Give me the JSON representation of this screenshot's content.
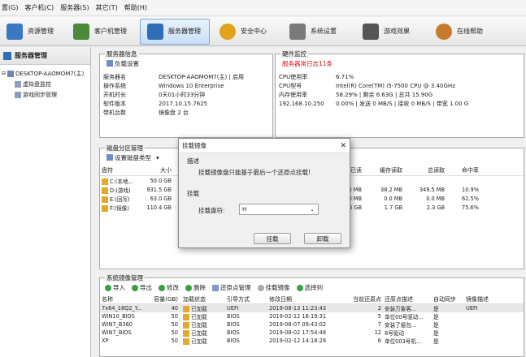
{
  "menu": [
    "置(G)",
    "客户机(C)",
    "服务器(S)",
    "其它(T)",
    "帮助(H)"
  ],
  "toolbar": [
    {
      "label": "资源管理",
      "color": "#3b78c2"
    },
    {
      "label": "客户机管理",
      "color": "#4a8a3a"
    },
    {
      "label": "服务器管理",
      "color": "#2f6db5"
    },
    {
      "label": "安全中心",
      "color": "#e2a21a"
    },
    {
      "label": "系统设置",
      "color": "#7a7a7a"
    },
    {
      "label": "游戏效果",
      "color": "#555555"
    },
    {
      "label": "在线帮助",
      "color": "#c77b2a"
    }
  ],
  "sidebar": {
    "title": "服务器管理",
    "tree": [
      {
        "label": "DESKTOP-AAOMOM7(主)",
        "indent": 0
      },
      {
        "label": "虚拟盘监控",
        "indent": 1
      },
      {
        "label": "游戏同步管理",
        "indent": 1
      }
    ]
  },
  "server_info": {
    "title": "服务器信息",
    "tool": "负载设置",
    "rows": [
      {
        "k": "服务器名",
        "v": "DESKTOP-AAOMOM7(主) | 启用"
      },
      {
        "k": "操作系统",
        "v": "Windows 10 Enterprise"
      },
      {
        "k": "开机时长",
        "v": "0天01小时33分钟"
      },
      {
        "k": "软件版本",
        "v": "2017.10.15.7625"
      },
      {
        "k": "带机台数",
        "v": "镜像盘 2 台"
      }
    ]
  },
  "hw": {
    "title": "硬件监控",
    "alert": "服务器常日志11条",
    "rows": [
      {
        "k": "CPU使用率",
        "v": "6.71%"
      },
      {
        "k": "CPU型号",
        "v": "Intel(R) Core(TM) i5-7500 CPU @ 3.40GHz"
      },
      {
        "k": "内存使用率",
        "v": "58.29% | 剩余 6.63G | 总共 15.90G"
      },
      {
        "k": "192.168.10.250",
        "v": "0.00% | 发送 0 MB/S | 接收 0 MB/S | 带宽 1.00 G"
      }
    ]
  },
  "disk": {
    "title": "磁盘分区管理",
    "tool": "设置磁盘类型",
    "headers": {
      "name": "盘符",
      "size": "大小",
      "hit_left": "已读",
      "cache": "缓存读取",
      "total": "总读取",
      "hit": "命中率"
    },
    "rows": [
      {
        "name": "C:(本地...",
        "size": "50.0 GB",
        "read": "",
        "cache": "",
        "total": "",
        "hit": ""
      },
      {
        "name": "D:(游戏)",
        "size": "931.5 GB",
        "read": "1.3 MB",
        "cache": "38.2 MB",
        "total": "349.5 MB",
        "hit": "10.9%"
      },
      {
        "name": "E:(回写)",
        "size": "63.0 GB",
        "read": "0.0 MB",
        "cache": "0.0 MB",
        "total": "0.0 MB",
        "hit": "62.5%"
      },
      {
        "name": "F:(镜像)",
        "size": "110.4 GB",
        "read": "1.6 GB",
        "cache": "1.7 GB",
        "total": "2.3 GB",
        "hit": "75.6%"
      }
    ]
  },
  "dialog": {
    "title": "挂载镜像",
    "desc_label": "描述",
    "desc": "挂载镜像盘只能基于最后一个还原点挂载!",
    "mount_label": "挂载",
    "disk_label": "挂载盘符:",
    "disk_value": "H",
    "ok": "挂载",
    "cancel": "卸载"
  },
  "image": {
    "title": "系统镜像管理",
    "tools": [
      "导入",
      "导出",
      "修改",
      "删除",
      "还原点管理",
      "挂载镜像",
      "选择列"
    ],
    "headers": [
      "名称",
      "容量(GB)",
      "加载状态",
      "引导方式",
      "修改日期",
      "当前还原点",
      "还原点描述",
      "自动同步",
      "镜像描述"
    ],
    "rows": [
      [
        "7x64_18Q2_Y...",
        "40",
        "已加载",
        "UEFI",
        "2019-08-13 11:23:43",
        "2",
        "安装万象客...",
        "是",
        "UEFI"
      ],
      [
        "WIN10_BIOS",
        "50",
        "已加载",
        "BIOS",
        "2019-02-12 16:19:31",
        "5",
        "单位00号驱动...",
        "是",
        ""
      ],
      [
        "WIN7_B360",
        "50",
        "已加载",
        "BIOS",
        "2019-08-07 09:43:02",
        "7",
        "安装了振包...",
        "是",
        ""
      ],
      [
        "WIN7_BIOS",
        "50",
        "已加载",
        "BIOS",
        "2019-08-02 17:54:48",
        "12",
        "8号驱动",
        "是",
        ""
      ],
      [
        "XP",
        "50",
        "已加载",
        "BIOS",
        "2019-02-12 14:18:28",
        "6",
        "单位003号机...",
        "是",
        ""
      ]
    ]
  }
}
